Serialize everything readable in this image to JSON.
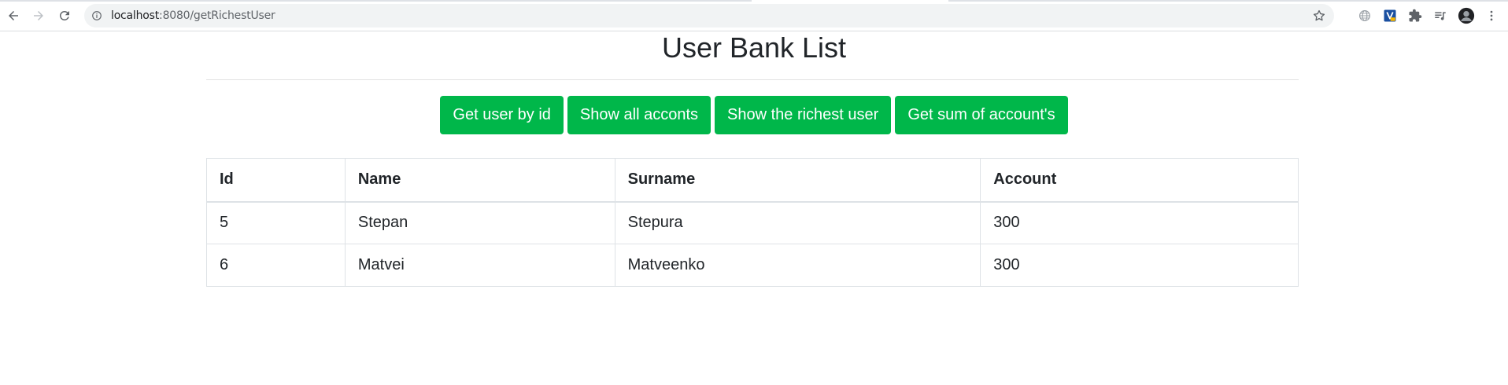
{
  "browser": {
    "url_host": "localhost",
    "url_rest": ":8080/getRichestUser",
    "icons": [
      "back-arrow-icon",
      "forward-arrow-icon",
      "reload-icon",
      "info-icon",
      "star-icon",
      "globe-icon",
      "extension-v-icon",
      "puzzle-icon",
      "media-queue-icon",
      "profile-avatar-icon",
      "more-vert-icon"
    ]
  },
  "page": {
    "title": "User Bank List"
  },
  "buttons": {
    "get_user_by_id": "Get user by id",
    "show_all_accounts": "Show all acconts",
    "show_richest_user": "Show the richest user",
    "get_sum": "Get sum of account's"
  },
  "table": {
    "headers": [
      "Id",
      "Name",
      "Surname",
      "Account"
    ],
    "rows": [
      [
        "5",
        "Stepan",
        "Stepura",
        "300"
      ],
      [
        "6",
        "Matvei",
        "Matveenko",
        "300"
      ]
    ]
  },
  "colors": {
    "button_bg": "#00b74a",
    "button_text": "#ffffff",
    "text": "#212529",
    "border": "#dee2e6"
  }
}
